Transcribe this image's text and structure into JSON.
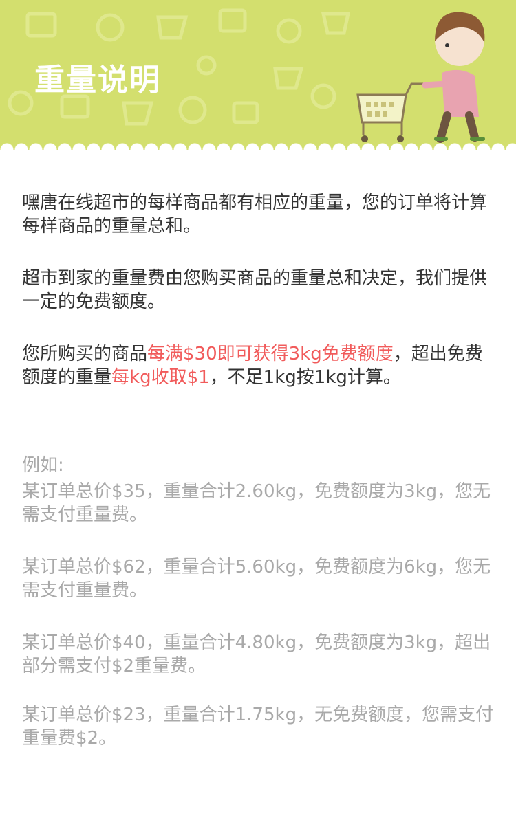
{
  "header": {
    "title": "重量说明",
    "background_color": "#d3df6e"
  },
  "content": {
    "p1": "嘿唐在线超市的每样商品都有相应的重量，您的订单将计算每样商品的重量总和。",
    "p2": "超市到家的重量费由您购买商品的重量总和决定，我们提供一定的免费额度。",
    "p3": {
      "a": "您所购买的商品",
      "b": "每满$30即可获得3kg免费额度",
      "c": "，超出免费额度的重量",
      "d": "每kg收取$1",
      "e": "，不足1kg按1kg计算。"
    },
    "highlight_color": "#f15b5b",
    "examples": {
      "label": "例如:",
      "items": [
        "某订单总价$35，重量合计2.60kg，免费额度为3kg，您无需支付重量费。",
        "某订单总价$62，重量合计5.60kg，免费额度为6kg，您无需支付重量费。",
        "某订单总价$40，重量合计4.80kg，免费额度为3kg，超出部分需支付$2重量费。",
        "某订单总价$23，重量合计1.75kg，无免费额度，您需支付重量费$2。"
      ]
    }
  }
}
